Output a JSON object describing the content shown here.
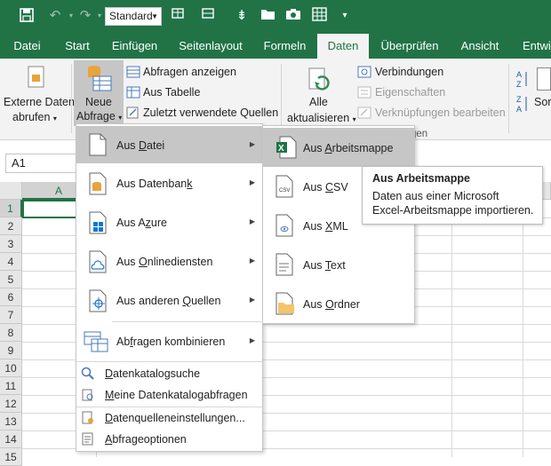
{
  "qat": {
    "style_value": "Standard"
  },
  "tabs": [
    "Datei",
    "Start",
    "Einfügen",
    "Seitenlayout",
    "Formeln",
    "Daten",
    "Überprüfen",
    "Ansicht",
    "Entwic"
  ],
  "ribbon": {
    "externe_daten_line1": "Externe Daten",
    "externe_daten_line2": "abrufen",
    "neue_abfrage_line1": "Neue",
    "neue_abfrage_line2": "Abfrage",
    "abfragen_anzeigen": "Abfragen anzeigen",
    "aus_tabelle": "Aus Tabelle",
    "zuletzt": "Zuletzt verwendete Quellen",
    "alle_line1": "Alle",
    "alle_line2": "aktualisieren",
    "verbindungen": "Verbindungen",
    "eigenschaften": "Eigenschaften",
    "verknuepfungen": "Verknüpfungen bearbeiten",
    "group_partial": "gen",
    "sort_partial": "Sor"
  },
  "namebox": "A1",
  "grid": {
    "columns": [
      "A"
    ],
    "rows": [
      "1",
      "2",
      "3",
      "4",
      "5",
      "6",
      "7",
      "8",
      "9",
      "10",
      "11",
      "12",
      "13",
      "14",
      "15"
    ]
  },
  "menu1": {
    "items": [
      {
        "pre": "Aus ",
        "u": "D",
        "post": "atei"
      },
      {
        "pre": "Aus Datenban",
        "u": "k",
        "post": ""
      },
      {
        "pre": "Aus A",
        "u": "z",
        "post": "ure"
      },
      {
        "pre": "Aus ",
        "u": "O",
        "post": "nlinediensten"
      },
      {
        "pre": "Aus anderen ",
        "u": "Q",
        "post": "uellen"
      },
      {
        "pre": "Ab",
        "u": "f",
        "post": "ragen kombinieren"
      }
    ],
    "bottom": [
      {
        "pre": "",
        "u": "D",
        "post": "atenkatalogsuche"
      },
      {
        "pre": "",
        "u": "M",
        "post": "eine Datenkatalogabfragen"
      },
      {
        "pre": "",
        "u": "D",
        "post": "atenquelleneinstellungen..."
      },
      {
        "pre": "",
        "u": "A",
        "post": "bfrageoptionen"
      }
    ]
  },
  "menu2": {
    "items": [
      {
        "pre": "Aus ",
        "u": "A",
        "post": "rbeitsmappe"
      },
      {
        "pre": "Aus ",
        "u": "C",
        "post": "SV"
      },
      {
        "pre": "Aus ",
        "u": "X",
        "post": "ML"
      },
      {
        "pre": "Aus ",
        "u": "T",
        "post": "ext"
      },
      {
        "pre": "Aus ",
        "u": "O",
        "post": "rdner"
      }
    ]
  },
  "tooltip": {
    "title": "Aus Arbeitsmappe",
    "line1": "Daten aus einer Microsoft",
    "line2": "Excel-Arbeitsmappe importieren."
  }
}
